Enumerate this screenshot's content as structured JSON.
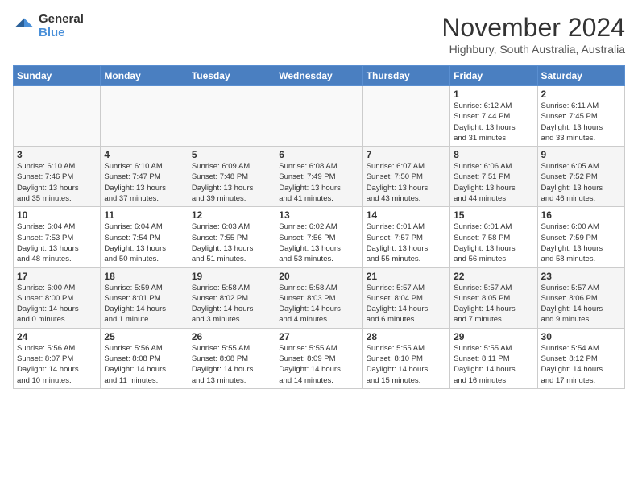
{
  "header": {
    "logo_general": "General",
    "logo_blue": "Blue",
    "month_title": "November 2024",
    "location": "Highbury, South Australia, Australia"
  },
  "weekdays": [
    "Sunday",
    "Monday",
    "Tuesday",
    "Wednesday",
    "Thursday",
    "Friday",
    "Saturday"
  ],
  "weeks": [
    [
      {
        "day": "",
        "info": ""
      },
      {
        "day": "",
        "info": ""
      },
      {
        "day": "",
        "info": ""
      },
      {
        "day": "",
        "info": ""
      },
      {
        "day": "",
        "info": ""
      },
      {
        "day": "1",
        "info": "Sunrise: 6:12 AM\nSunset: 7:44 PM\nDaylight: 13 hours\nand 31 minutes."
      },
      {
        "day": "2",
        "info": "Sunrise: 6:11 AM\nSunset: 7:45 PM\nDaylight: 13 hours\nand 33 minutes."
      }
    ],
    [
      {
        "day": "3",
        "info": "Sunrise: 6:10 AM\nSunset: 7:46 PM\nDaylight: 13 hours\nand 35 minutes."
      },
      {
        "day": "4",
        "info": "Sunrise: 6:10 AM\nSunset: 7:47 PM\nDaylight: 13 hours\nand 37 minutes."
      },
      {
        "day": "5",
        "info": "Sunrise: 6:09 AM\nSunset: 7:48 PM\nDaylight: 13 hours\nand 39 minutes."
      },
      {
        "day": "6",
        "info": "Sunrise: 6:08 AM\nSunset: 7:49 PM\nDaylight: 13 hours\nand 41 minutes."
      },
      {
        "day": "7",
        "info": "Sunrise: 6:07 AM\nSunset: 7:50 PM\nDaylight: 13 hours\nand 43 minutes."
      },
      {
        "day": "8",
        "info": "Sunrise: 6:06 AM\nSunset: 7:51 PM\nDaylight: 13 hours\nand 44 minutes."
      },
      {
        "day": "9",
        "info": "Sunrise: 6:05 AM\nSunset: 7:52 PM\nDaylight: 13 hours\nand 46 minutes."
      }
    ],
    [
      {
        "day": "10",
        "info": "Sunrise: 6:04 AM\nSunset: 7:53 PM\nDaylight: 13 hours\nand 48 minutes."
      },
      {
        "day": "11",
        "info": "Sunrise: 6:04 AM\nSunset: 7:54 PM\nDaylight: 13 hours\nand 50 minutes."
      },
      {
        "day": "12",
        "info": "Sunrise: 6:03 AM\nSunset: 7:55 PM\nDaylight: 13 hours\nand 51 minutes."
      },
      {
        "day": "13",
        "info": "Sunrise: 6:02 AM\nSunset: 7:56 PM\nDaylight: 13 hours\nand 53 minutes."
      },
      {
        "day": "14",
        "info": "Sunrise: 6:01 AM\nSunset: 7:57 PM\nDaylight: 13 hours\nand 55 minutes."
      },
      {
        "day": "15",
        "info": "Sunrise: 6:01 AM\nSunset: 7:58 PM\nDaylight: 13 hours\nand 56 minutes."
      },
      {
        "day": "16",
        "info": "Sunrise: 6:00 AM\nSunset: 7:59 PM\nDaylight: 13 hours\nand 58 minutes."
      }
    ],
    [
      {
        "day": "17",
        "info": "Sunrise: 6:00 AM\nSunset: 8:00 PM\nDaylight: 14 hours\nand 0 minutes."
      },
      {
        "day": "18",
        "info": "Sunrise: 5:59 AM\nSunset: 8:01 PM\nDaylight: 14 hours\nand 1 minute."
      },
      {
        "day": "19",
        "info": "Sunrise: 5:58 AM\nSunset: 8:02 PM\nDaylight: 14 hours\nand 3 minutes."
      },
      {
        "day": "20",
        "info": "Sunrise: 5:58 AM\nSunset: 8:03 PM\nDaylight: 14 hours\nand 4 minutes."
      },
      {
        "day": "21",
        "info": "Sunrise: 5:57 AM\nSunset: 8:04 PM\nDaylight: 14 hours\nand 6 minutes."
      },
      {
        "day": "22",
        "info": "Sunrise: 5:57 AM\nSunset: 8:05 PM\nDaylight: 14 hours\nand 7 minutes."
      },
      {
        "day": "23",
        "info": "Sunrise: 5:57 AM\nSunset: 8:06 PM\nDaylight: 14 hours\nand 9 minutes."
      }
    ],
    [
      {
        "day": "24",
        "info": "Sunrise: 5:56 AM\nSunset: 8:07 PM\nDaylight: 14 hours\nand 10 minutes."
      },
      {
        "day": "25",
        "info": "Sunrise: 5:56 AM\nSunset: 8:08 PM\nDaylight: 14 hours\nand 11 minutes."
      },
      {
        "day": "26",
        "info": "Sunrise: 5:55 AM\nSunset: 8:08 PM\nDaylight: 14 hours\nand 13 minutes."
      },
      {
        "day": "27",
        "info": "Sunrise: 5:55 AM\nSunset: 8:09 PM\nDaylight: 14 hours\nand 14 minutes."
      },
      {
        "day": "28",
        "info": "Sunrise: 5:55 AM\nSunset: 8:10 PM\nDaylight: 14 hours\nand 15 minutes."
      },
      {
        "day": "29",
        "info": "Sunrise: 5:55 AM\nSunset: 8:11 PM\nDaylight: 14 hours\nand 16 minutes."
      },
      {
        "day": "30",
        "info": "Sunrise: 5:54 AM\nSunset: 8:12 PM\nDaylight: 14 hours\nand 17 minutes."
      }
    ]
  ]
}
